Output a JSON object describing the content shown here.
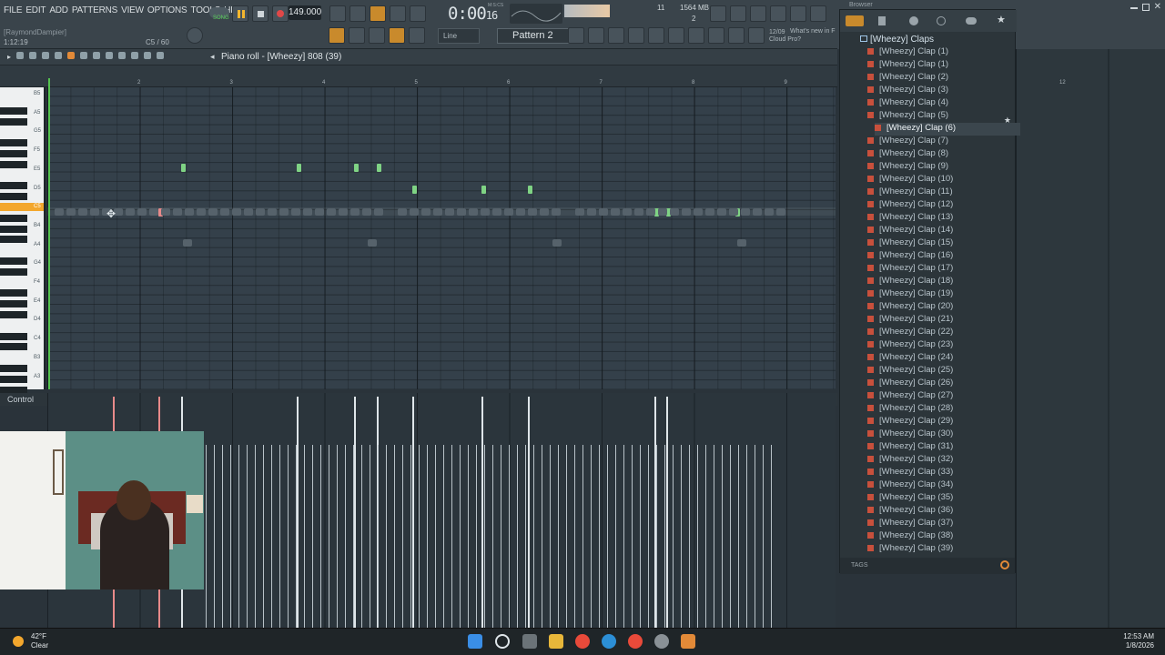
{
  "menu": [
    "FILE",
    "EDIT",
    "ADD",
    "PATTERNS",
    "VIEW",
    "OPTIONS",
    "TOOLS",
    "HELP"
  ],
  "toolbar": {
    "song_label": "SONG",
    "tempo": "149.000",
    "time": "0:00",
    "time_frames": "16",
    "time_unit": "M:S:CS",
    "memory": "1564 MB",
    "polyphony": "11",
    "cpu_num": "2",
    "hint": "[RaymondDampier]",
    "song_position": "1:12:19",
    "hint_value": "C5 / 60",
    "snap": "Line",
    "pattern": "Pattern 2",
    "news_date": "12/09",
    "news_line1": "What's new in F",
    "news_line2": "Cloud Pro?"
  },
  "piano_roll": {
    "title": "Piano roll - [Wheezy] 808 (39)",
    "bars": [
      "2",
      "3",
      "4",
      "5",
      "6",
      "7",
      "8",
      "9"
    ],
    "right_bar": "12",
    "key_labels": [
      "B5",
      "A5",
      "G5",
      "F5",
      "E5",
      "D5",
      "C5",
      "B4",
      "A4",
      "G4",
      "F4",
      "E4",
      "D4",
      "C4",
      "B3",
      "A3"
    ],
    "highlight_key": "C5"
  },
  "control": {
    "label": "Control"
  },
  "browser": {
    "title": "Browser",
    "folder": "[Wheezy] Claps",
    "selected_index": 6,
    "items": [
      "[Wheezy] Clap (1)",
      "[Wheezy] Clap (1)",
      "[Wheezy] Clap (2)",
      "[Wheezy] Clap (3)",
      "[Wheezy] Clap (4)",
      "[Wheezy] Clap (5)",
      "[Wheezy] Clap (6)",
      "[Wheezy] Clap (7)",
      "[Wheezy] Clap (8)",
      "[Wheezy] Clap (9)",
      "[Wheezy] Clap (10)",
      "[Wheezy] Clap (11)",
      "[Wheezy] Clap (12)",
      "[Wheezy] Clap (13)",
      "[Wheezy] Clap (14)",
      "[Wheezy] Clap (15)",
      "[Wheezy] Clap (16)",
      "[Wheezy] Clap (17)",
      "[Wheezy] Clap (18)",
      "[Wheezy] Clap (19)",
      "[Wheezy] Clap (20)",
      "[Wheezy] Clap (21)",
      "[Wheezy] Clap (22)",
      "[Wheezy] Clap (23)",
      "[Wheezy] Clap (24)",
      "[Wheezy] Clap (25)",
      "[Wheezy] Clap (26)",
      "[Wheezy] Clap (27)",
      "[Wheezy] Clap (28)",
      "[Wheezy] Clap (29)",
      "[Wheezy] Clap (30)",
      "[Wheezy] Clap (31)",
      "[Wheezy] Clap (32)",
      "[Wheezy] Clap (33)",
      "[Wheezy] Clap (34)",
      "[Wheezy] Clap (35)",
      "[Wheezy] Clap (36)",
      "[Wheezy] Clap (37)",
      "[Wheezy] Clap (38)",
      "[Wheezy] Clap (39)"
    ],
    "tags_label": "TAGS"
  },
  "taskbar": {
    "temperature": "42°F",
    "condition": "Clear",
    "time": "12:53 AM",
    "date": "1/8/2026"
  },
  "colors": {
    "note": "#7fd384",
    "note_selected": "#e88a8a",
    "playhead": "#55c24f",
    "accent": "#f3b62e"
  }
}
